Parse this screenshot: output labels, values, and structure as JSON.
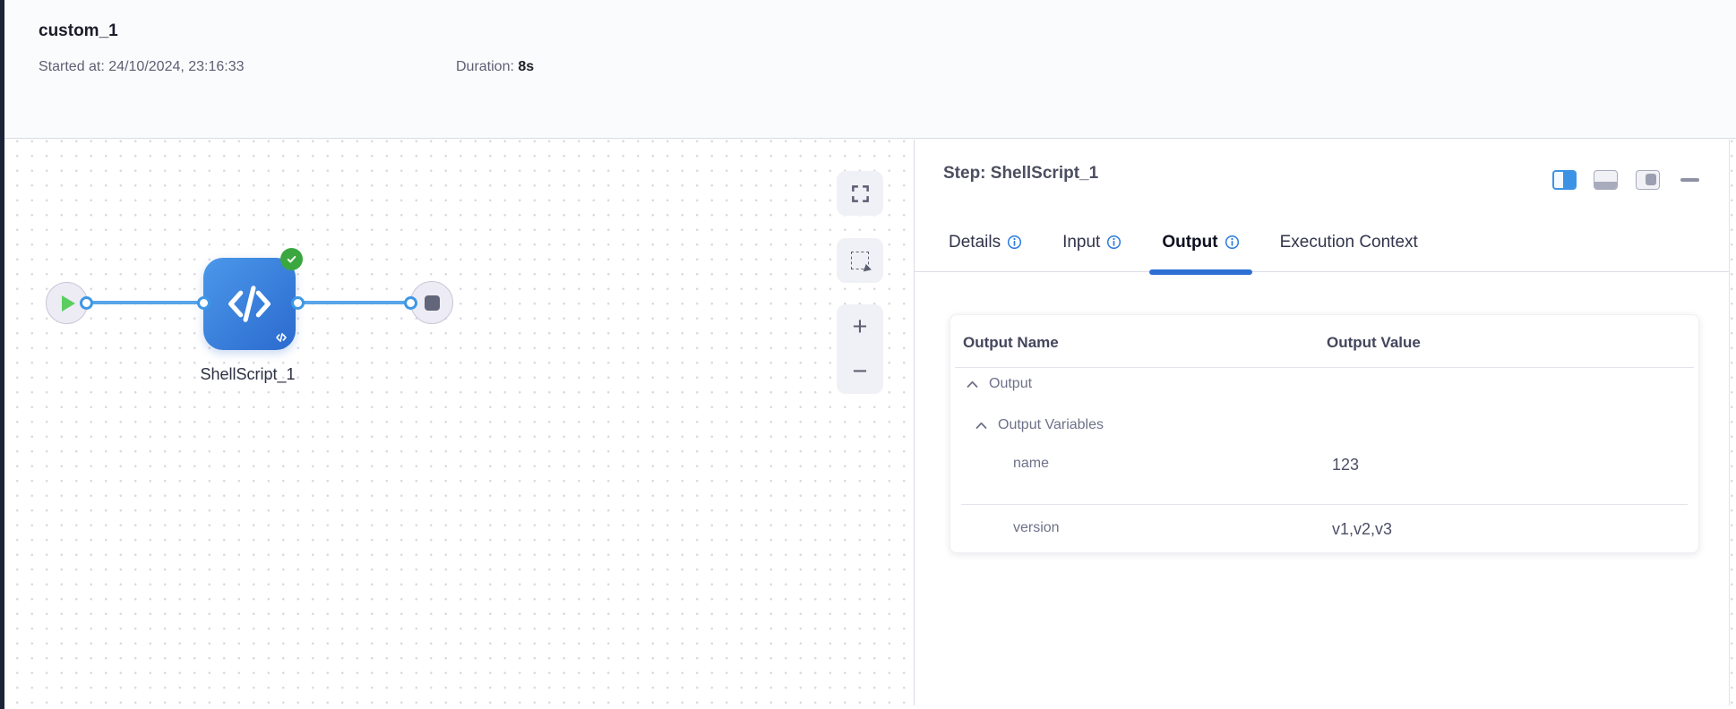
{
  "header": {
    "title": "custom_1",
    "started_label": "Started at:",
    "started_value": "24/10/2024, 23:16:33",
    "duration_label": "Duration:",
    "duration_value": "8s"
  },
  "canvas": {
    "node_label": "ShellScript_1",
    "controls": {
      "zoom_in": "+",
      "zoom_out": "−"
    }
  },
  "panel": {
    "title": "Step: ShellScript_1",
    "tabs": [
      {
        "label": "Details"
      },
      {
        "label": "Input"
      },
      {
        "label": "Output"
      },
      {
        "label": "Execution Context"
      }
    ],
    "table": {
      "columns": [
        "Output Name",
        "Output Value"
      ],
      "groups": [
        {
          "label": "Output"
        },
        {
          "label": "Output Variables"
        }
      ],
      "rows": [
        {
          "name": "name",
          "value": "123"
        },
        {
          "name": "version",
          "value": "v1,v2,v3"
        }
      ]
    }
  },
  "colors": {
    "accent_blue": "#2e6fd6",
    "edge_blue": "#58a6e9",
    "node_blue_start": "#4b98ea",
    "node_blue_end": "#2b6ace",
    "success_green": "#3aa83f",
    "info_blue": "#2e7ce0",
    "sidebar_dark": "#1a2338"
  }
}
